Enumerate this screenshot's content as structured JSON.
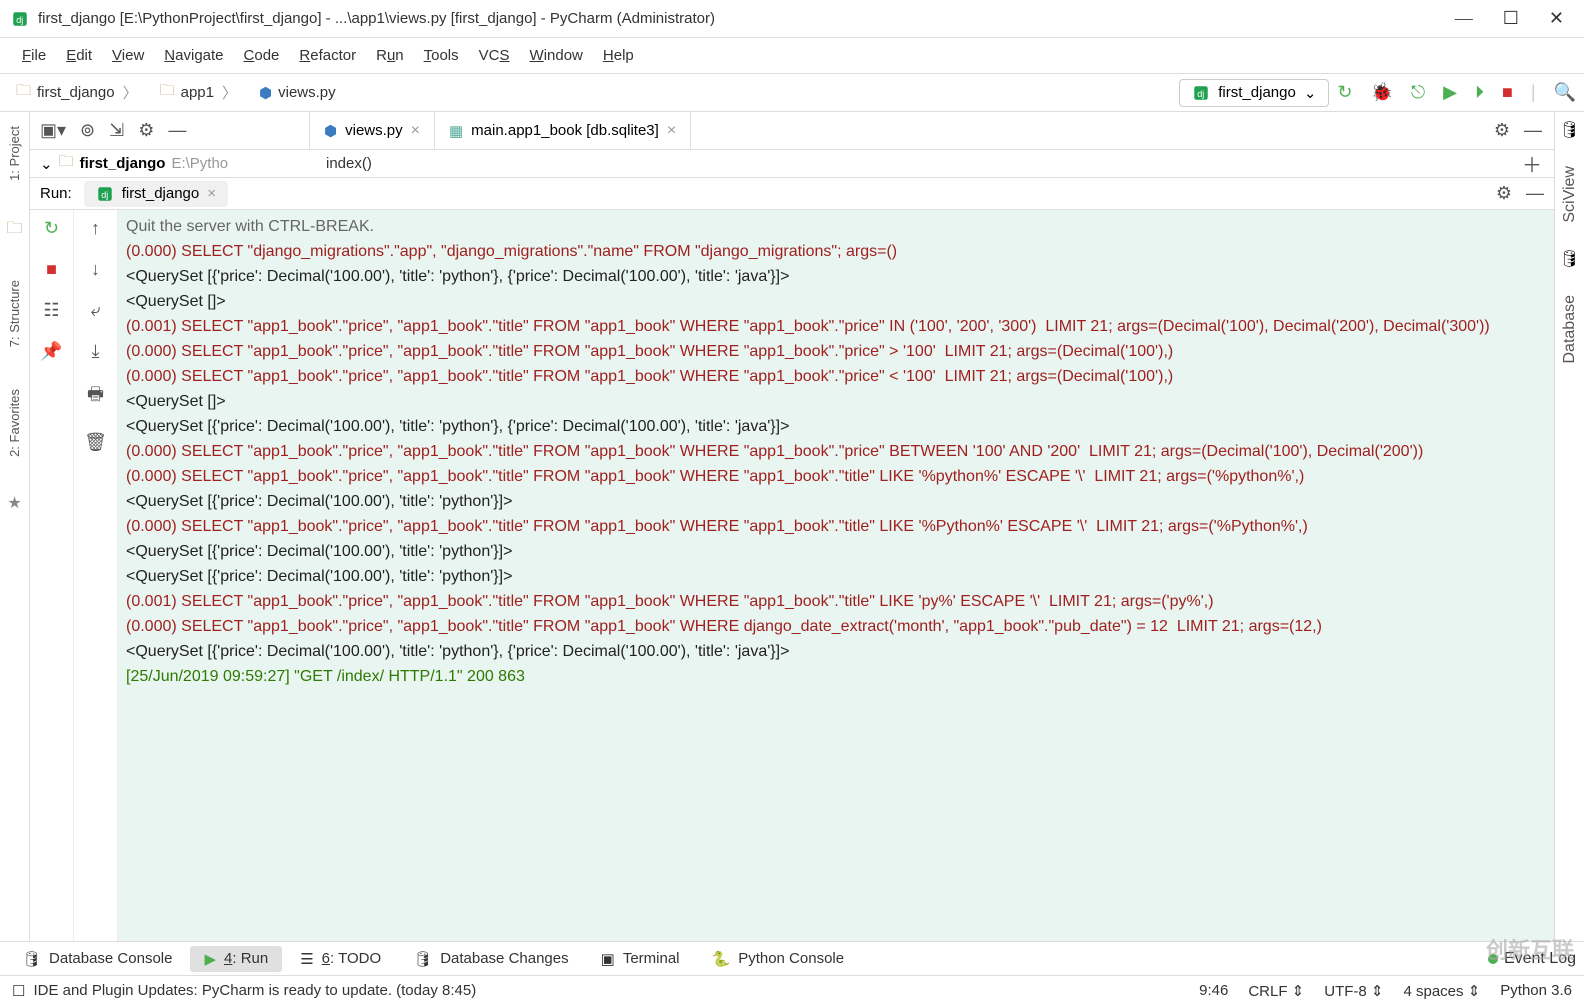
{
  "title_bar": {
    "title": "first_django [E:\\PythonProject\\first_django] - ...\\app1\\views.py [first_django] - PyCharm (Administrator)"
  },
  "menu": [
    "File",
    "Edit",
    "View",
    "Navigate",
    "Code",
    "Refactor",
    "Run",
    "Tools",
    "VCS",
    "Window",
    "Help"
  ],
  "breadcrumb": {
    "items": [
      "first_django",
      "app1",
      "views.py"
    ]
  },
  "run_config": {
    "label": "first_django"
  },
  "left_rail": [
    "1: Project",
    "7: Structure",
    "2: Favorites"
  ],
  "right_rail": [
    "SciView",
    "Database"
  ],
  "editor_tabs": {
    "tab1": "views.py",
    "tab2": "main.app1_book [db.sqlite3]"
  },
  "project_tree": {
    "name": "first_django",
    "path": "E:\\Pytho"
  },
  "nav_line": "index()",
  "run_panel": {
    "label": "Run:",
    "tab": "first_django"
  },
  "console_lines": [
    {
      "cls": "gray",
      "text": "Quit the server with CTRL-BREAK."
    },
    {
      "cls": "red",
      "text": "(0.000) SELECT \"django_migrations\".\"app\", \"django_migrations\".\"name\" FROM \"django_migrations\"; args=()"
    },
    {
      "cls": "black",
      "text": "<QuerySet [{'price': Decimal('100.00'), 'title': 'python'}, {'price': Decimal('100.00'), 'title': 'java'}]>"
    },
    {
      "cls": "black",
      "text": "<QuerySet []>"
    },
    {
      "cls": "red",
      "text": "(0.001) SELECT \"app1_book\".\"price\", \"app1_book\".\"title\" FROM \"app1_book\" WHERE \"app1_book\".\"price\" IN ('100', '200', '300')  LIMIT 21; args=(Decimal('100'), Decimal('200'), Decimal('300'))"
    },
    {
      "cls": "red",
      "text": "(0.000) SELECT \"app1_book\".\"price\", \"app1_book\".\"title\" FROM \"app1_book\" WHERE \"app1_book\".\"price\" > '100'  LIMIT 21; args=(Decimal('100'),)"
    },
    {
      "cls": "red",
      "text": "(0.000) SELECT \"app1_book\".\"price\", \"app1_book\".\"title\" FROM \"app1_book\" WHERE \"app1_book\".\"price\" < '100'  LIMIT 21; args=(Decimal('100'),)"
    },
    {
      "cls": "black",
      "text": "<QuerySet []>"
    },
    {
      "cls": "black",
      "text": "<QuerySet [{'price': Decimal('100.00'), 'title': 'python'}, {'price': Decimal('100.00'), 'title': 'java'}]>"
    },
    {
      "cls": "red",
      "text": "(0.000) SELECT \"app1_book\".\"price\", \"app1_book\".\"title\" FROM \"app1_book\" WHERE \"app1_book\".\"price\" BETWEEN '100' AND '200'  LIMIT 21; args=(Decimal('100'), Decimal('200'))"
    },
    {
      "cls": "red",
      "text": "(0.000) SELECT \"app1_book\".\"price\", \"app1_book\".\"title\" FROM \"app1_book\" WHERE \"app1_book\".\"title\" LIKE '%python%' ESCAPE '\\'  LIMIT 21; args=('%python%',)"
    },
    {
      "cls": "black",
      "text": "<QuerySet [{'price': Decimal('100.00'), 'title': 'python'}]>"
    },
    {
      "cls": "red",
      "text": "(0.000) SELECT \"app1_book\".\"price\", \"app1_book\".\"title\" FROM \"app1_book\" WHERE \"app1_book\".\"title\" LIKE '%Python%' ESCAPE '\\'  LIMIT 21; args=('%Python%',)"
    },
    {
      "cls": "black",
      "text": "<QuerySet [{'price': Decimal('100.00'), 'title': 'python'}]>"
    },
    {
      "cls": "black",
      "text": "<QuerySet [{'price': Decimal('100.00'), 'title': 'python'}]>"
    },
    {
      "cls": "red",
      "text": "(0.001) SELECT \"app1_book\".\"price\", \"app1_book\".\"title\" FROM \"app1_book\" WHERE \"app1_book\".\"title\" LIKE 'py%' ESCAPE '\\'  LIMIT 21; args=('py%',)"
    },
    {
      "cls": "red",
      "text": "(0.000) SELECT \"app1_book\".\"price\", \"app1_book\".\"title\" FROM \"app1_book\" WHERE django_date_extract('month', \"app1_book\".\"pub_date\") = 12  LIMIT 21; args=(12,)"
    },
    {
      "cls": "black",
      "text": "<QuerySet [{'price': Decimal('100.00'), 'title': 'python'}, {'price': Decimal('100.00'), 'title': 'java'}]>"
    },
    {
      "cls": "green",
      "text": "[25/Jun/2019 09:59:27] \"GET /index/ HTTP/1.1\" 200 863"
    }
  ],
  "bottom_tabs": {
    "db_console": "Database Console",
    "run": "4: Run",
    "todo": "6: TODO",
    "db_changes": "Database Changes",
    "terminal": "Terminal",
    "py_console": "Python Console",
    "event_log": "Event Log"
  },
  "status_bar": {
    "message": "IDE and Plugin Updates: PyCharm is ready to update. (today 8:45)",
    "cursor": "9:46",
    "sep": "CRLF",
    "enc": "UTF-8",
    "indent": "4 spaces",
    "interp": "Python 3.6"
  },
  "watermark": "创新互联"
}
